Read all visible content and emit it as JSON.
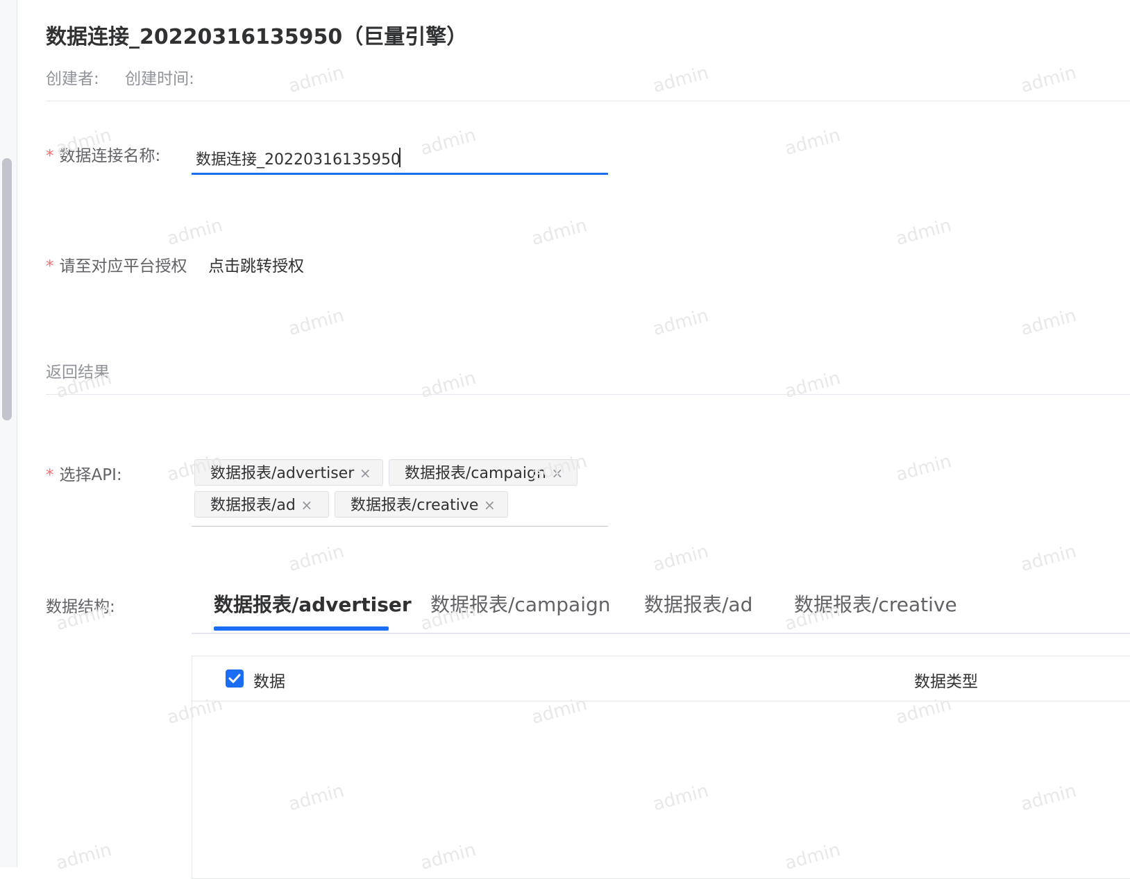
{
  "header": {
    "title": "数据连接_20220316135950（巨量引擎）",
    "creator_label": "创建者:",
    "created_time_label": "创建时间:"
  },
  "form": {
    "required_mark": "*",
    "name_label": "数据连接名称:",
    "name_value": "数据连接_20220316135950",
    "auth_label": "请至对应平台授权",
    "auth_link": "点击跳转授权",
    "result_label": "返回结果",
    "api_label": "选择API:",
    "api_tags": [
      "数据报表/advertiser",
      "数据报表/campaign",
      "数据报表/ad",
      "数据报表/creative"
    ],
    "tag_close": "×",
    "structure_label": "数据结构:"
  },
  "tabs": [
    {
      "label": "数据报表/advertiser",
      "active": true
    },
    {
      "label": "数据报表/campaign",
      "active": false
    },
    {
      "label": "数据报表/ad",
      "active": false
    },
    {
      "label": "数据报表/creative",
      "active": false
    }
  ],
  "table": {
    "columns": [
      "数据",
      "数据类型"
    ],
    "select_all_checked": true
  },
  "watermark": "admin",
  "colors": {
    "primary": "#1b6ef3",
    "required": "#f56c6c",
    "watermark": "#e8e8e8"
  }
}
